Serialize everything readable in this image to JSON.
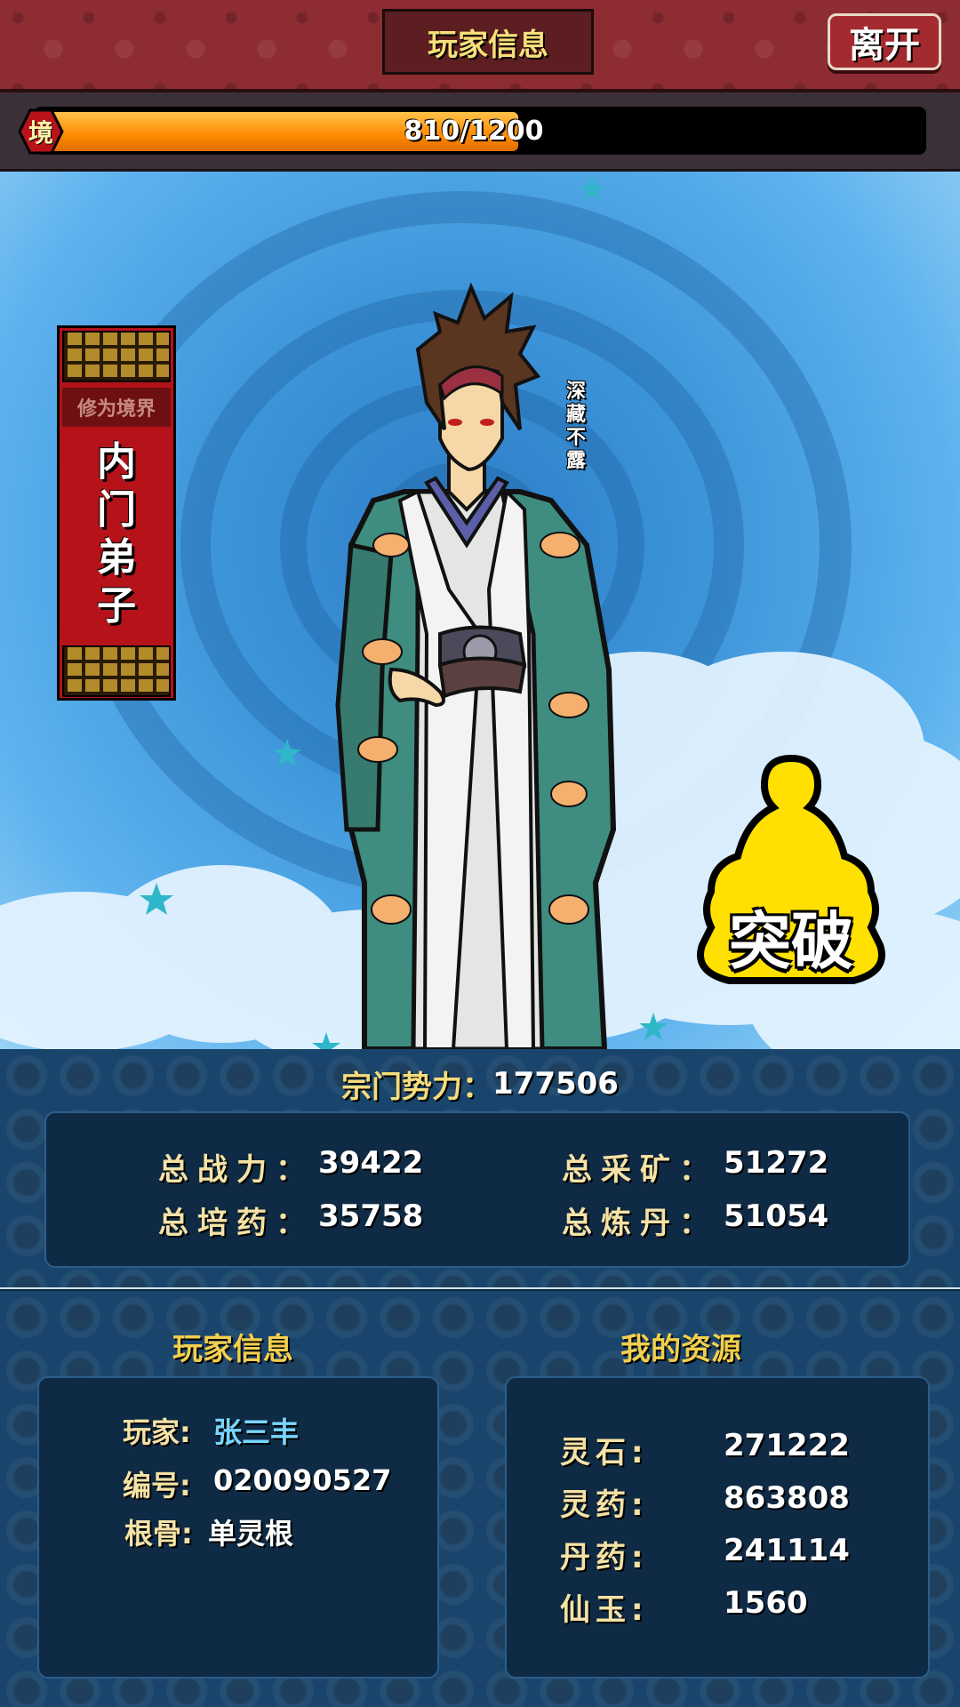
{
  "header": {
    "title": "玩家信息",
    "leave_label": "离开"
  },
  "progress": {
    "badge": "境",
    "current": 810,
    "max": 1200,
    "text": "810/1200",
    "fraction": 0.675
  },
  "realm_scroll": {
    "subtitle": "修为境界",
    "rank_chars": [
      "内",
      "门",
      "弟",
      "子"
    ]
  },
  "character": {
    "title_chars": [
      "深",
      "藏",
      "不",
      "露"
    ]
  },
  "breakthrough": {
    "label": "突破",
    "color": "#ffe000"
  },
  "sect": {
    "label": "宗门势力：",
    "value": "177506"
  },
  "stats": {
    "combat_label": "总战力：",
    "combat_value": "39422",
    "mining_label": "总采矿：",
    "mining_value": "51272",
    "herb_label": "总培药：",
    "herb_value": "35758",
    "alchemy_label": "总炼丹：",
    "alchemy_value": "51054"
  },
  "player_info": {
    "title": "玩家信息",
    "name_label": "玩家:",
    "name_value": "张三丰",
    "id_label": "编号:",
    "id_value": "020090527",
    "root_label": "根骨:",
    "root_value": "单灵根"
  },
  "resources": {
    "title": "我的资源",
    "items": [
      {
        "label": "灵石:",
        "value": "271222"
      },
      {
        "label": "灵药:",
        "value": "863808"
      },
      {
        "label": "丹药:",
        "value": "241114"
      },
      {
        "label": "仙玉:",
        "value": "1560"
      }
    ]
  },
  "colors": {
    "top_bar": "#8e2c33",
    "progress_fill": "#ff8a00",
    "panel_bg": "#0f2a44",
    "accent_gold": "#f2cf4e"
  }
}
